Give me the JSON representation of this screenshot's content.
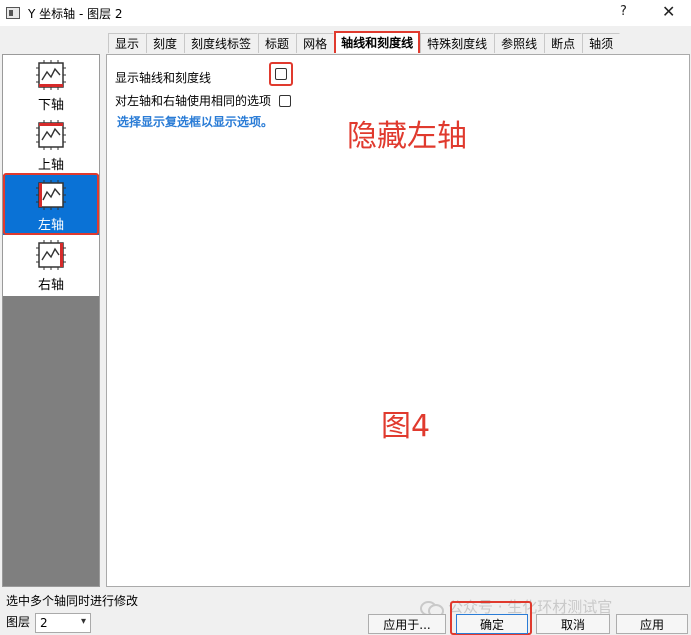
{
  "window": {
    "title": "Y 坐标轴 - 图层 2",
    "help_label": "?",
    "close_label": "✕"
  },
  "tabs": [
    {
      "label": "显示"
    },
    {
      "label": "刻度"
    },
    {
      "label": "刻度线标签"
    },
    {
      "label": "标题"
    },
    {
      "label": "网格"
    },
    {
      "label": "轴线和刻度线",
      "active": true
    },
    {
      "label": "特殊刻度线"
    },
    {
      "label": "参照线"
    },
    {
      "label": "断点"
    },
    {
      "label": "轴须"
    }
  ],
  "sidebar": {
    "items": [
      {
        "label": "下轴",
        "icon": "bottom-axis-icon"
      },
      {
        "label": "上轴",
        "icon": "top-axis-icon"
      },
      {
        "label": "左轴",
        "icon": "left-axis-icon",
        "selected": true
      },
      {
        "label": "右轴",
        "icon": "right-axis-icon"
      }
    ]
  },
  "panel": {
    "show_axis_label": "显示轴线和刻度线",
    "show_axis_checked": false,
    "same_options_label": "对左轴和右轴使用相同的选项",
    "same_options_checked": false,
    "hint": "选择显示复选框以显示选项。"
  },
  "annotations": {
    "hide_left_axis": "隐藏左轴",
    "figure_label": "图4"
  },
  "footer": {
    "note": "选中多个轴同时进行修改",
    "layer_label": "图层",
    "layer_value": "2",
    "apply_to_label": "应用于...",
    "ok_label": "确定",
    "cancel_label": "取消",
    "apply_label": "应用"
  },
  "watermark": {
    "text": "公众号 · 生化环材测试官"
  },
  "colors": {
    "highlight": "#e03a2e",
    "selection": "#0a72d6",
    "hint": "#2a7cd6"
  }
}
